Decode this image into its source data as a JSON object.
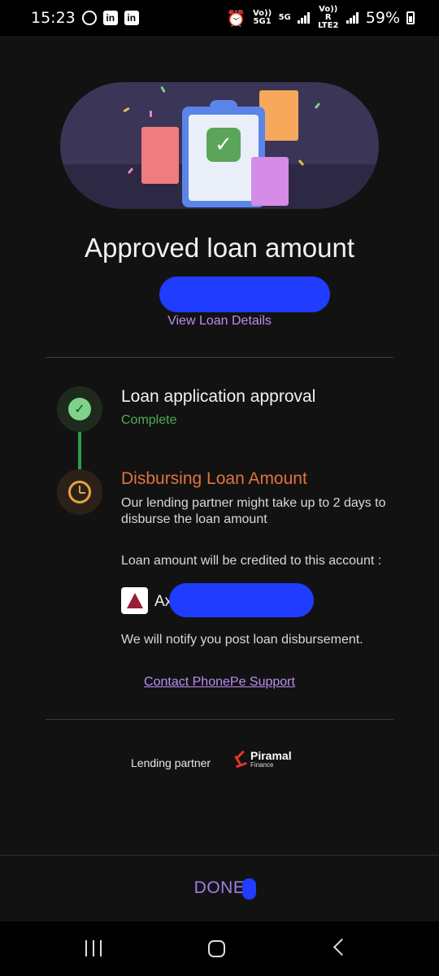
{
  "status_bar": {
    "time": "15:23",
    "network_1": "Vo)) 5G1",
    "network_type": "5G",
    "network_2": "Vo)) R LTE2",
    "battery": "59%",
    "notification_icons": [
      "whatsapp-icon",
      "linkedin-icon",
      "linkedin-icon"
    ]
  },
  "main": {
    "title": "Approved loan amount",
    "view_details_link": "View Loan Details"
  },
  "steps": [
    {
      "title": "Loan application approval",
      "status": "Complete",
      "status_color": "#4caf50"
    },
    {
      "title": "Disbursing Loan Amount",
      "description": "Our lending partner might take up to 2 days to disburse the loan amount",
      "title_color": "#e3733b"
    }
  ],
  "account": {
    "note": "Loan amount will be credited to this account :",
    "bank_name_visible": "Ax"
  },
  "notify_text": "We will notify you post loan disbursement.",
  "support_link": "Contact PhonePe Support",
  "lending_partner": {
    "label": "Lending partner",
    "name": "Piramal",
    "sub": "Finance"
  },
  "footer": {
    "done_label": "DONE"
  },
  "colors": {
    "accent": "#b98ef0",
    "success": "#4caf50",
    "warning": "#e3733b",
    "background": "#121212"
  }
}
